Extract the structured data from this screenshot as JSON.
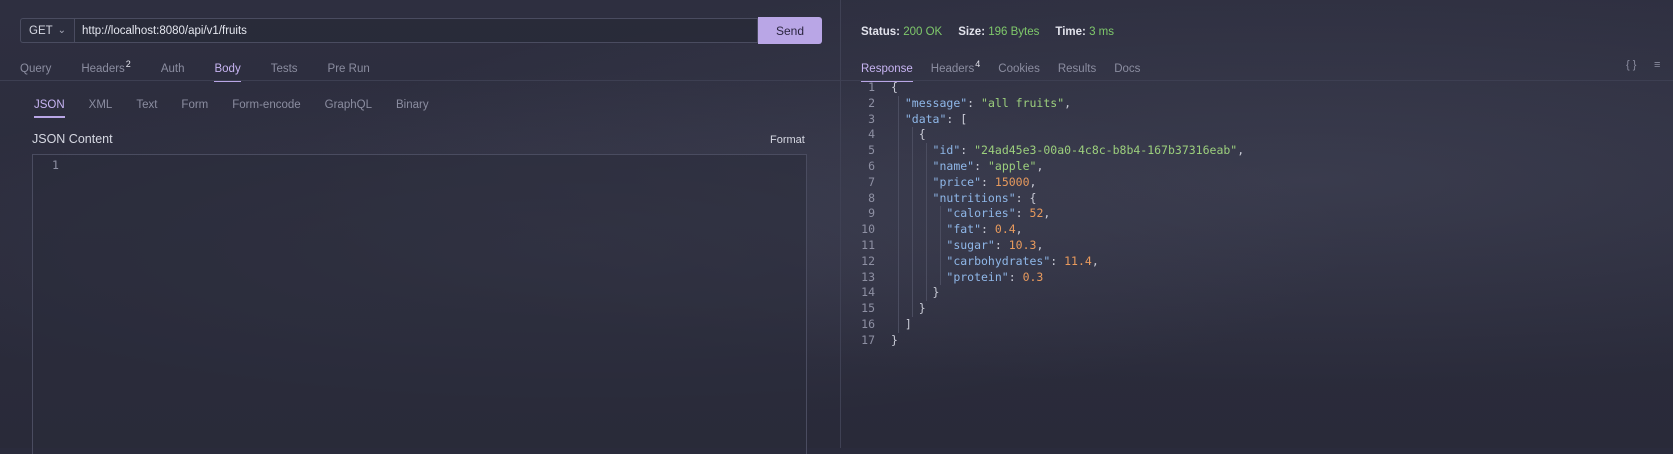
{
  "request": {
    "method": "GET",
    "url": "http://localhost:8080/api/v1/fruits",
    "send_label": "Send",
    "tabs": [
      {
        "label": "Query"
      },
      {
        "label": "Headers",
        "badge": "2"
      },
      {
        "label": "Auth"
      },
      {
        "label": "Body",
        "active": true
      },
      {
        "label": "Tests"
      },
      {
        "label": "Pre Run"
      }
    ],
    "body_tabs": [
      "JSON",
      "XML",
      "Text",
      "Form",
      "Form-encode",
      "GraphQL",
      "Binary"
    ],
    "json_content_title": "JSON Content",
    "format_label": "Format",
    "editor_line": "1"
  },
  "response": {
    "status_label": "Status:",
    "status_value": "200 OK",
    "size_label": "Size:",
    "size_value": "196 Bytes",
    "time_label": "Time:",
    "time_value": "3 ms",
    "tabs": [
      {
        "label": "Response",
        "active": true
      },
      {
        "label": "Headers",
        "badge": "4"
      },
      {
        "label": "Cookies"
      },
      {
        "label": "Results"
      },
      {
        "label": "Docs"
      }
    ],
    "icons": [
      "braces-icon",
      "wrap-lines-icon"
    ],
    "body_lines": [
      "{",
      "  \"message\": \"all fruits\",",
      "  \"data\": [",
      "    {",
      "      \"id\": \"24ad45e3-00a0-4c8c-b8b4-167b37316eab\",",
      "      \"name\": \"apple\",",
      "      \"price\": 15000,",
      "      \"nutritions\": {",
      "        \"calories\": 52,",
      "        \"fat\": 0.4,",
      "        \"sugar\": 10.3,",
      "        \"carbohydrates\": 11.4,",
      "        \"protein\": 0.3",
      "      }",
      "    }",
      "  ]",
      "}"
    ]
  },
  "colors": {
    "accent": "#b9a6e6",
    "success": "#7fc96b",
    "json_key": "#8fb7e8",
    "json_string": "#9ccf7d",
    "json_number": "#e89a5d"
  }
}
